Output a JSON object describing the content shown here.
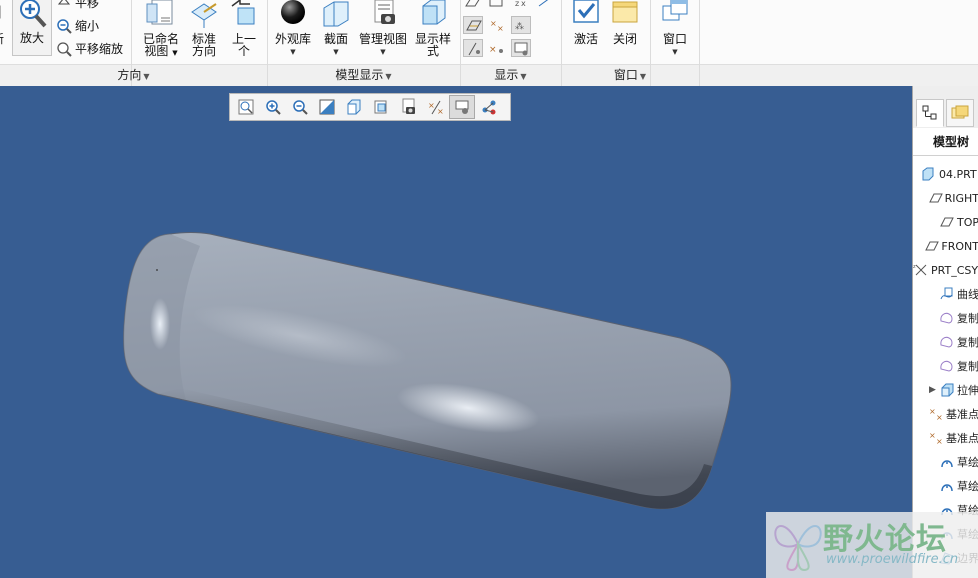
{
  "ribbon": {
    "orientation": {
      "label": "方向",
      "zoom_in": "放大",
      "zoom_out": "缩小",
      "pan": "平移",
      "pan_zoom": "平移缩放",
      "named_views": [
        "已命名",
        "视图"
      ],
      "standard_orient": [
        "标准",
        "方向"
      ],
      "previous": [
        "上一",
        "个"
      ]
    },
    "model_display": {
      "label": "模型显示",
      "appearance": "外观库",
      "section": "截面",
      "manage_views": "管理视图",
      "display_style": [
        "显示样",
        "式"
      ]
    },
    "display": {
      "label": "显示"
    },
    "window": {
      "label": "窗口",
      "activate": "激活",
      "close": "关闭",
      "windows": "窗口"
    }
  },
  "model_tree": {
    "title": "模型树",
    "items": [
      {
        "label": "04.PRT",
        "icon": "part-icon",
        "expand": ""
      },
      {
        "label": "RIGHT",
        "icon": "datum-plane-icon",
        "expand": ""
      },
      {
        "label": "TOP",
        "icon": "datum-plane-icon",
        "expand": ""
      },
      {
        "label": "FRONT",
        "icon": "datum-plane-icon",
        "expand": ""
      },
      {
        "label": "PRT_CSYS_DEF",
        "icon": "csys-icon",
        "expand": ""
      },
      {
        "label": "曲线",
        "icon": "curve-icon",
        "expand": ""
      },
      {
        "label": "复制",
        "icon": "copy-icon",
        "expand": ""
      },
      {
        "label": "复制",
        "icon": "copy-icon",
        "expand": ""
      },
      {
        "label": "复制",
        "icon": "copy-icon",
        "expand": ""
      },
      {
        "label": "拉伸",
        "icon": "extrude-icon",
        "expand": "▶"
      },
      {
        "label": "基准点",
        "icon": "datum-point-icon",
        "expand": ""
      },
      {
        "label": "基准点",
        "icon": "datum-point-icon",
        "expand": ""
      },
      {
        "label": "草绘",
        "icon": "sketch-icon",
        "expand": ""
      },
      {
        "label": "草绘",
        "icon": "sketch-icon",
        "expand": ""
      },
      {
        "label": "草绘",
        "icon": "sketch-icon",
        "expand": ""
      },
      {
        "label": "草绘",
        "icon": "sketch-icon",
        "expand": ""
      },
      {
        "label": "边界",
        "icon": "boundary-icon",
        "expand": ""
      }
    ]
  },
  "watermark": {
    "title": "野火论坛",
    "url": "www.proewildfire.cn"
  },
  "colors": {
    "viewport_bg": "#375d92",
    "model_surface": "#8e98a8",
    "ribbon_bg": "#fbfbfb",
    "accent": "#2c6fb8"
  }
}
